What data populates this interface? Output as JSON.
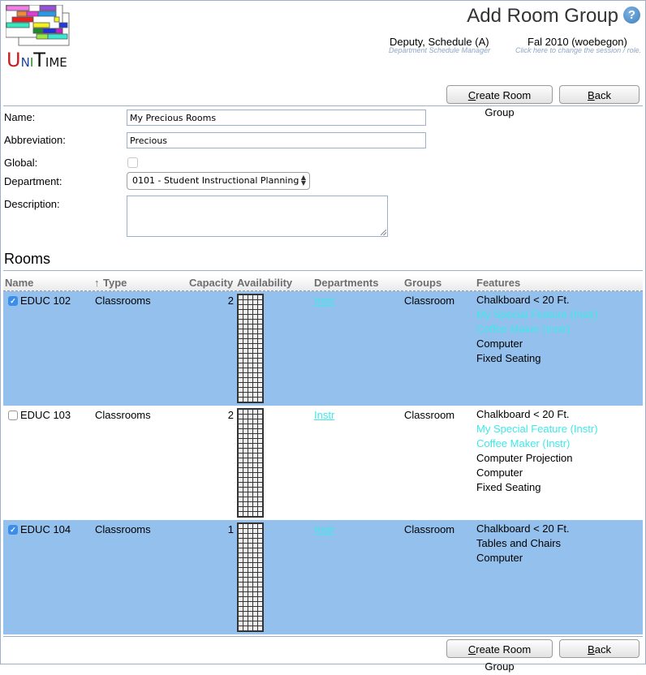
{
  "header": {
    "logo_text": [
      "U",
      "N",
      "I",
      "T",
      "IME"
    ],
    "title": "Add Room Group",
    "help_icon": "question-circle-icon",
    "user": {
      "name": "Deputy, Schedule (A)",
      "role": "Department Schedule Manager"
    },
    "session": {
      "name": "Fal 2010 (woebegon)",
      "hint": "Click here to change the session / role."
    }
  },
  "buttons": {
    "create_accesskey": "C",
    "create_rest": "reate Room Group",
    "back_accesskey": "B",
    "back_rest": "ack"
  },
  "form": {
    "name_label": "Name:",
    "name_value": "My Precious Rooms",
    "abbreviation_label": "Abbreviation:",
    "abbreviation_value": "Precious",
    "global_label": "Global:",
    "global_checked": false,
    "department_label": "Department:",
    "department_selected": "0101 - Student Instructional Planning",
    "description_label": "Description:",
    "description_value": ""
  },
  "rooms": {
    "title": "Rooms",
    "columns": {
      "name": "Name",
      "type_sort_icon": "↑",
      "type": "Type",
      "capacity": "Capacity",
      "availability": "Availability",
      "departments": "Departments",
      "groups": "Groups",
      "features": "Features"
    },
    "rows": [
      {
        "checked": true,
        "name": "EDUC 102",
        "type": "Classrooms",
        "capacity": "2",
        "departments": "Instr",
        "groups": "Classroom",
        "features": [
          {
            "label": "Chalkboard < 20 Ft.",
            "instr": false
          },
          {
            "label": "My Special Feature (Instr)",
            "instr": true
          },
          {
            "label": "Coffee Maker (Instr)",
            "instr": true
          },
          {
            "label": "Computer",
            "instr": false
          },
          {
            "label": "Fixed Seating",
            "instr": false
          }
        ]
      },
      {
        "checked": false,
        "name": "EDUC 103",
        "type": "Classrooms",
        "capacity": "2",
        "departments": "Instr",
        "groups": "Classroom",
        "features": [
          {
            "label": "Chalkboard < 20 Ft.",
            "instr": false
          },
          {
            "label": "My Special Feature (Instr)",
            "instr": true
          },
          {
            "label": "Coffee Maker (Instr)",
            "instr": true
          },
          {
            "label": "Computer Projection",
            "instr": false
          },
          {
            "label": "Computer",
            "instr": false
          },
          {
            "label": "Fixed Seating",
            "instr": false
          }
        ]
      },
      {
        "checked": true,
        "name": "EDUC 104",
        "type": "Classrooms",
        "capacity": "1",
        "departments": "Instr",
        "groups": "Classroom",
        "features": [
          {
            "label": "Chalkboard < 20 Ft.",
            "instr": false
          },
          {
            "label": "Tables and Chairs",
            "instr": false
          },
          {
            "label": "Computer",
            "instr": false
          }
        ]
      }
    ]
  },
  "colors": {
    "selected_row": "#93c0ec",
    "instr_link": "#40e8e8",
    "border": "#9cb0ce"
  }
}
